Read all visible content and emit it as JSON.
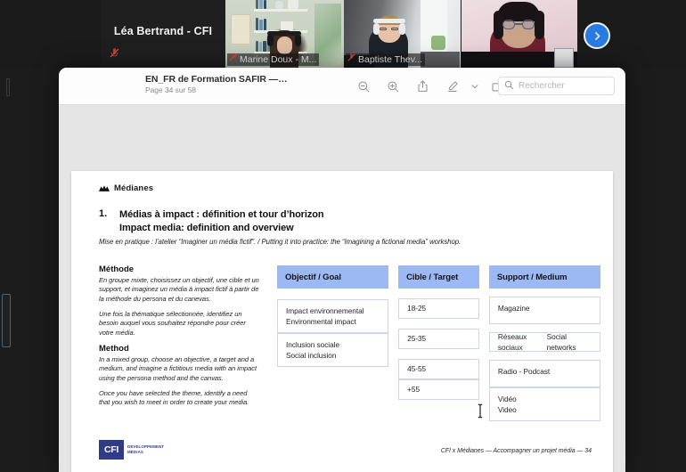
{
  "video_conference": {
    "spotlight": {
      "name": "Léa Bertrand - CFI",
      "muted_icon": "mic-off-icon"
    },
    "tiles": [
      {
        "label": "Marine Doux - M...",
        "muted_icon": "mic-off-icon",
        "active": true
      },
      {
        "label": "Baptiste Thev...",
        "muted_icon": "mic-off-icon",
        "active": false
      },
      {
        "label": "",
        "muted_icon": "mic-off-icon",
        "active": false
      }
    ],
    "next_button": {
      "icon": "chevron-right-icon",
      "accent": "#2a7ae4"
    }
  },
  "preview_window": {
    "title": "EN_FR de Formation SAFIR — C...",
    "page_status": "Page 34 sur 58",
    "toolbar": [
      {
        "name": "zoom-out-button",
        "icon": "magnifier-minus-icon"
      },
      {
        "name": "zoom-in-button",
        "icon": "magnifier-plus-icon"
      },
      {
        "name": "share-button",
        "icon": "share-icon"
      },
      {
        "name": "markup-button",
        "icon": "pen-underline-icon"
      },
      {
        "name": "markup-dropdown",
        "icon": "chevron-down-icon"
      },
      {
        "name": "rotate-button",
        "icon": "rotate-icon"
      },
      {
        "name": "highlight-button",
        "icon": "highlighter-circle-icon"
      }
    ],
    "search": {
      "placeholder": "Rechercher",
      "icon": "search-icon",
      "value": ""
    }
  },
  "slide": {
    "brand": {
      "mark": "medianes-mountains-icon",
      "name": "Médianes"
    },
    "heading": {
      "number": "1.",
      "title_fr": "Médias à impact : définition et tour d’horizon",
      "title_en": "Impact media: definition and overview",
      "subtitle": "Mise en pratique : l’atelier “Imaginer un média fictif”. / Putting it into practice: the “Imagining a fictional media” workshop."
    },
    "method": {
      "fr_heading": "Méthode",
      "fr_p1": "En groupe mixte, choisissez un objectif, une cible et un support, et imaginez un média à impact fictif à partir de la méthode du persona et du canevas.",
      "fr_p2": "Une fois la thématique sélectionnée, identifiez un besoin auquel vous souhaitez répondre pour créer votre média.",
      "en_heading": "Method",
      "en_p1": "In a mixed group, choose an objective, a target and a medium, and imagine a fictitious media with an impact using the persona method and the canvas.",
      "en_p2": "Once you have selected the theme, identify a need that you wish to meet in order to create your media."
    },
    "header_color": "#9cb8f5",
    "card_border_color": "#c9d7ef",
    "columns": [
      {
        "name": "goal",
        "header": "Objectif / Goal",
        "cards": [
          {
            "line1": "Impact environnemental",
            "line2": "Environmental impact"
          },
          {
            "line1": "Inclusion sociale",
            "line2": "Social inclusion"
          }
        ]
      },
      {
        "name": "target",
        "header": "Cible / Target",
        "cards": [
          {
            "line1": "18-25",
            "line2": ""
          },
          {
            "line1": "25-35",
            "line2": ""
          },
          {
            "line1": "45-55",
            "line2": ""
          },
          {
            "line1": "+55",
            "line2": ""
          }
        ]
      },
      {
        "name": "medium",
        "header": "Support / Medium",
        "cards": [
          {
            "line1": "Magazine",
            "line2": ""
          },
          {
            "line1": "Réseaux sociaux",
            "line2": "Social networks"
          },
          {
            "line1": "Radio - Podcast",
            "line2": ""
          },
          {
            "line1": "Vidéo",
            "line2": "Video"
          }
        ]
      }
    ],
    "footer": {
      "logo_text": "CFI",
      "logo_sub_line1": "DÉVELOPPEMENT",
      "logo_sub_line2": "MÉDIAS",
      "logo_color": "#2f3b85",
      "credit": "CFI x Médianes — Accompagner un projet média  — 34"
    }
  }
}
